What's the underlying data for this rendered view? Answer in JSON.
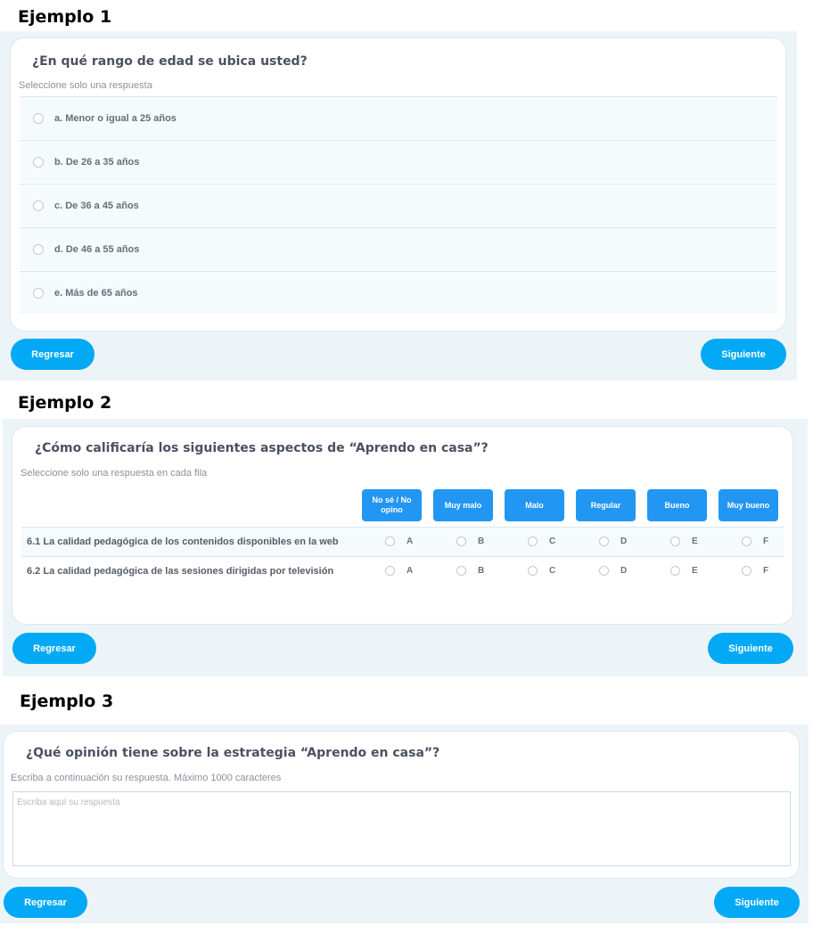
{
  "example1": {
    "title": "Ejemplo 1",
    "question": "¿En qué rango de edad se ubica usted?",
    "hint": "Seleccione solo una respuesta",
    "options": [
      "a. Menor o igual a 25 años",
      "b. De 26 a 35 años",
      "c. De 36 a 45 años",
      "d. De 46 a 55 años",
      "e. Más de 65 años"
    ],
    "back_label": "Regresar",
    "next_label": "Siguiente"
  },
  "example2": {
    "title": "Ejemplo 2",
    "question": "¿Cómo calificaría los siguientes aspectos de “Aprendo en casa”?",
    "hint": "Seleccione solo una respuesta en cada fila",
    "columns": [
      "No sé / No opino",
      "Muy malo",
      "Malo",
      "Regular",
      "Bueno",
      "Muy bueno"
    ],
    "column_letters": [
      "A",
      "B",
      "C",
      "D",
      "E",
      "F"
    ],
    "rows": [
      "6.1 La calidad pedagógica de los contenidos disponibles en la web",
      "6.2 La calidad pedagógica de las sesiones dirigidas por televisión"
    ],
    "back_label": "Regresar",
    "next_label": "Siguiente"
  },
  "example3": {
    "title": "Ejemplo 3",
    "question": "¿Qué opinión tiene sobre la estrategia “Aprendo en casa”?",
    "hint": "Escriba a continuación su respuesta. Máximo 1000 caracteres",
    "placeholder": "Escriba aquí su respuesta",
    "back_label": "Regresar",
    "next_label": "Siguiente"
  },
  "colors": {
    "button": "#03a9f4",
    "column_header": "#2196f3",
    "panel": "#edf4f8"
  }
}
